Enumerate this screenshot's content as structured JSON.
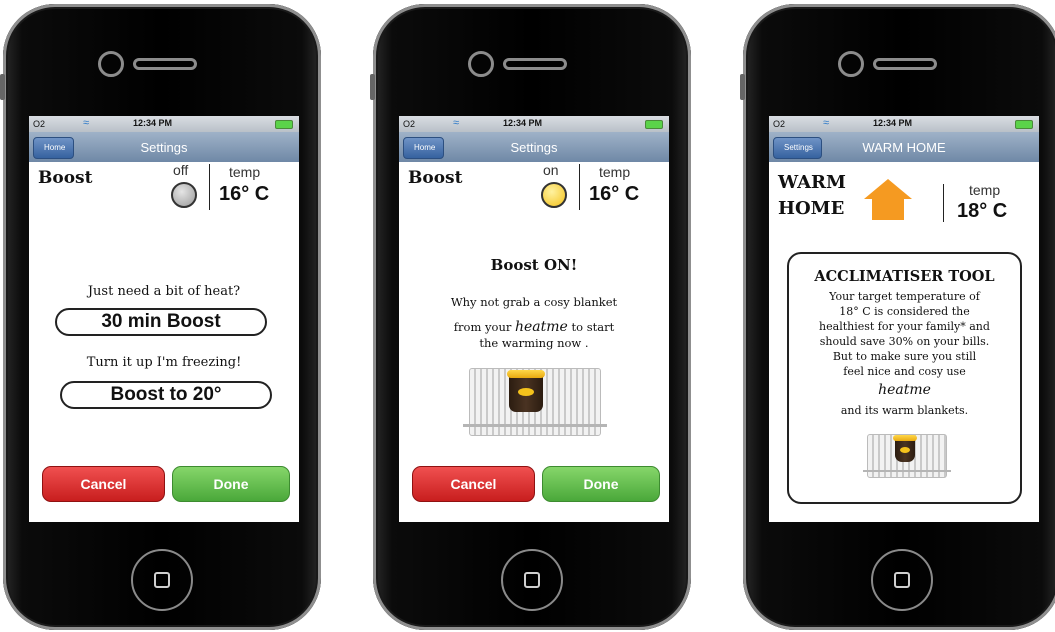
{
  "status_bar": {
    "carrier": "O2",
    "time": "12:34 PM"
  },
  "screens": [
    {
      "nav": {
        "back_label": "Home",
        "title": "Settings"
      },
      "boost_title": "Boost",
      "boost_state": "off",
      "temp_label": "temp",
      "temp_value": "16° C",
      "prompt": "Just need a bit of heat?",
      "option1": "30 min Boost",
      "prompt2": "Turn it up I'm freezing!",
      "option2": "Boost to 20°",
      "cancel": "Cancel",
      "done": "Done"
    },
    {
      "nav": {
        "back_label": "Home",
        "title": "Settings"
      },
      "boost_title": "Boost",
      "boost_state": "on",
      "temp_label": "temp",
      "temp_value": "16° C",
      "heading": "Boost ON!",
      "line1": "Why not grab a cosy blanket",
      "line2_pre": "from your",
      "brand": "heatme",
      "line2_post": "to start",
      "line3": "the warming now .",
      "cancel": "Cancel",
      "done": "Done"
    },
    {
      "nav": {
        "back_label": "Settings",
        "title": "WARM HOME"
      },
      "title_line1": "WARM",
      "title_line2": "HOME",
      "temp_label": "temp",
      "temp_value": "18° C",
      "tool_title": "ACCLIMATISER TOOL",
      "tool_lines": [
        "Your target temperature of",
        "18° C is considered the",
        "healthiest for your family* and",
        "should save 30% on your bills.",
        "But to make sure you still",
        "feel nice and cosy use"
      ],
      "brand": "heatme",
      "tool_last": "and its warm blankets."
    }
  ],
  "colors": {
    "cancel": "#d62828",
    "done": "#5cb848",
    "house": "#f59a21",
    "knob_on": "#f4c21c"
  }
}
